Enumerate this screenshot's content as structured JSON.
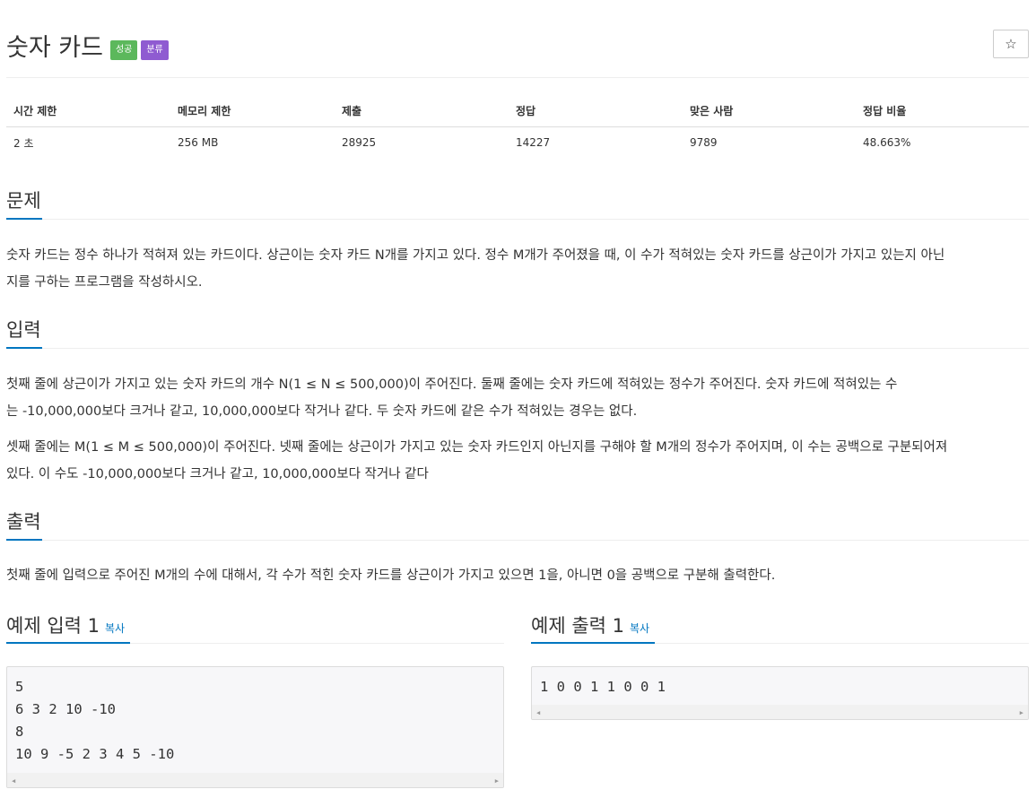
{
  "problem": {
    "title": "숫자 카드",
    "badges": {
      "success": "성공",
      "category": "분류"
    },
    "star": "☆"
  },
  "info_table": {
    "headers": [
      "시간 제한",
      "메모리 제한",
      "제출",
      "정답",
      "맞은 사람",
      "정답 비율"
    ],
    "values": [
      "2 초",
      "256 MB",
      "28925",
      "14227",
      "9789",
      "48.663%"
    ]
  },
  "sections": {
    "description": {
      "title": "문제",
      "line1": "숫자 카드는 정수 하나가 적혀져 있는 카드이다. 상근이는 숫자 카드 N개를 가지고 있다. 정수 M개가 주어졌을 때, 이 수가 적혀있는 숫자 카드를 상근이가 가지고 있는지 아닌",
      "line2": "지를 구하는 프로그램을 작성하시오."
    },
    "input": {
      "title": "입력",
      "p1_line1": "첫째 줄에 상근이가 가지고 있는 숫자 카드의 개수 N(1 ≤ N ≤ 500,000)이 주어진다. 둘째 줄에는 숫자 카드에 적혀있는 정수가 주어진다. 숫자 카드에 적혀있는 수",
      "p1_line2": "는 -10,000,000보다 크거나 같고, 10,000,000보다 작거나 같다. 두 숫자 카드에 같은 수가 적혀있는 경우는 없다.",
      "p2_line1": "셋째 줄에는 M(1 ≤ M ≤ 500,000)이 주어진다. 넷째 줄에는 상근이가 가지고 있는 숫자 카드인지 아닌지를 구해야 할 M개의 정수가 주어지며, 이 수는 공백으로 구분되어져",
      "p2_line2": "있다. 이 수도 -10,000,000보다 크거나 같고, 10,000,000보다 작거나 같다"
    },
    "output": {
      "title": "출력",
      "line1": "첫째 줄에 입력으로 주어진 M개의 수에 대해서, 각 수가 적힌 숫자 카드를 상근이가 가지고 있으면 1을, 아니면 0을 공백으로 구분해 출력한다."
    }
  },
  "samples": {
    "input": {
      "title": "예제 입력 1",
      "copy": "복사",
      "lines": [
        "5",
        "6 3 2 10 -10",
        "8",
        "10 9 -5 2 3 4 5 -10"
      ]
    },
    "output": {
      "title": "예제 출력 1",
      "copy": "복사",
      "lines": [
        "1 0 0 1 1 0 0 1"
      ]
    }
  }
}
